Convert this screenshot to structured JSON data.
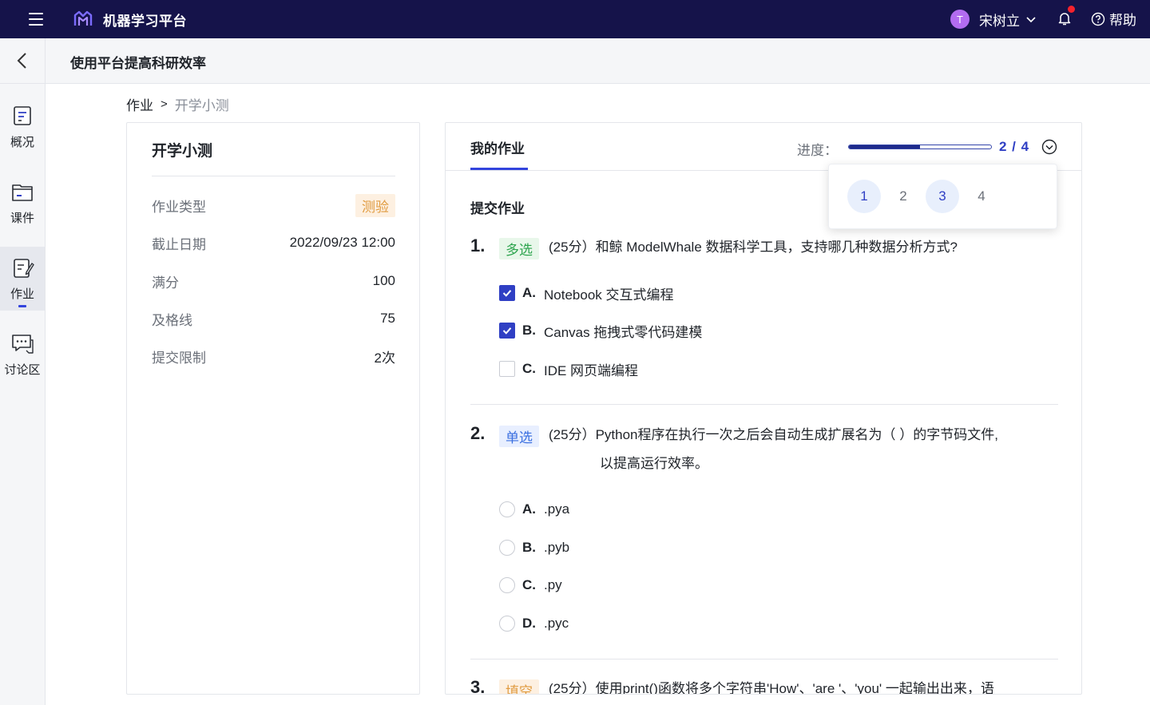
{
  "app": {
    "title": "机器学习平台"
  },
  "user": {
    "avatar_initial": "T",
    "name": "宋树立"
  },
  "header": {
    "help_label": "帮助"
  },
  "course": {
    "title": "使用平台提高科研效率"
  },
  "nav": [
    {
      "label": "概况",
      "icon": "overview-icon"
    },
    {
      "label": "课件",
      "icon": "courseware-icon"
    },
    {
      "label": "作业",
      "icon": "homework-icon",
      "active": true
    },
    {
      "label": "讨论区",
      "icon": "discussion-icon"
    }
  ],
  "breadcrumb": {
    "parent": "作业",
    "separator": ">",
    "current": "开学小测"
  },
  "info": {
    "title": "开学小测",
    "rows": [
      {
        "key": "作业类型",
        "value": "测验"
      },
      {
        "key": "截止日期",
        "value": "2022/09/23 12:00"
      },
      {
        "key": "满分",
        "value": "100"
      },
      {
        "key": "及格线",
        "value": "75"
      },
      {
        "key": "提交限制",
        "value": "2次"
      }
    ]
  },
  "homework": {
    "tab_label": "我的作业",
    "progress_label": "进度：",
    "progress_text": "2 / 4",
    "progress_fraction": 0.5,
    "section_title": "提交作业",
    "questions": [
      {
        "number": "1.",
        "tag": "多选",
        "text": "(25分）和鲸 ModelWhale 数据科学工具，支持哪几种数据分析方式?",
        "options": [
          {
            "letter": "A.",
            "text": "Notebook 交互式编程",
            "checked": true
          },
          {
            "letter": "B.",
            "text": "Canvas 拖拽式零代码建模",
            "checked": true
          },
          {
            "letter": "C.",
            "text": "IDE 网页端编程",
            "checked": false
          }
        ]
      },
      {
        "number": "2.",
        "tag": "单选",
        "text": "(25分）Python程序在执行一次之后会自动生成扩展名为（ ）的字节码文件,",
        "text_line2": "以提高运行效率。",
        "options": [
          {
            "letter": "A.",
            "text": ".pya"
          },
          {
            "letter": "B.",
            "text": ".pyb"
          },
          {
            "letter": "C.",
            "text": ".py"
          },
          {
            "letter": "D.",
            "text": ".pyc"
          }
        ]
      },
      {
        "number": "3.",
        "tag": "填空",
        "text": "(25分）使用print()函数将多个字符串'How'、'are '、'you' 一起输出出来，语"
      }
    ],
    "question_nav": [
      {
        "label": "1",
        "answered": true
      },
      {
        "label": "2",
        "answered": false
      },
      {
        "label": "3",
        "answered": true
      },
      {
        "label": "4",
        "answered": false
      }
    ]
  },
  "colors": {
    "topbar": "#15134a",
    "accent": "#2f3fc4",
    "multi_tag": "#2da44e",
    "single_tag": "#3a6fe0",
    "fill_tag": "#e09a3e",
    "notification_dot": "#f5222d"
  }
}
